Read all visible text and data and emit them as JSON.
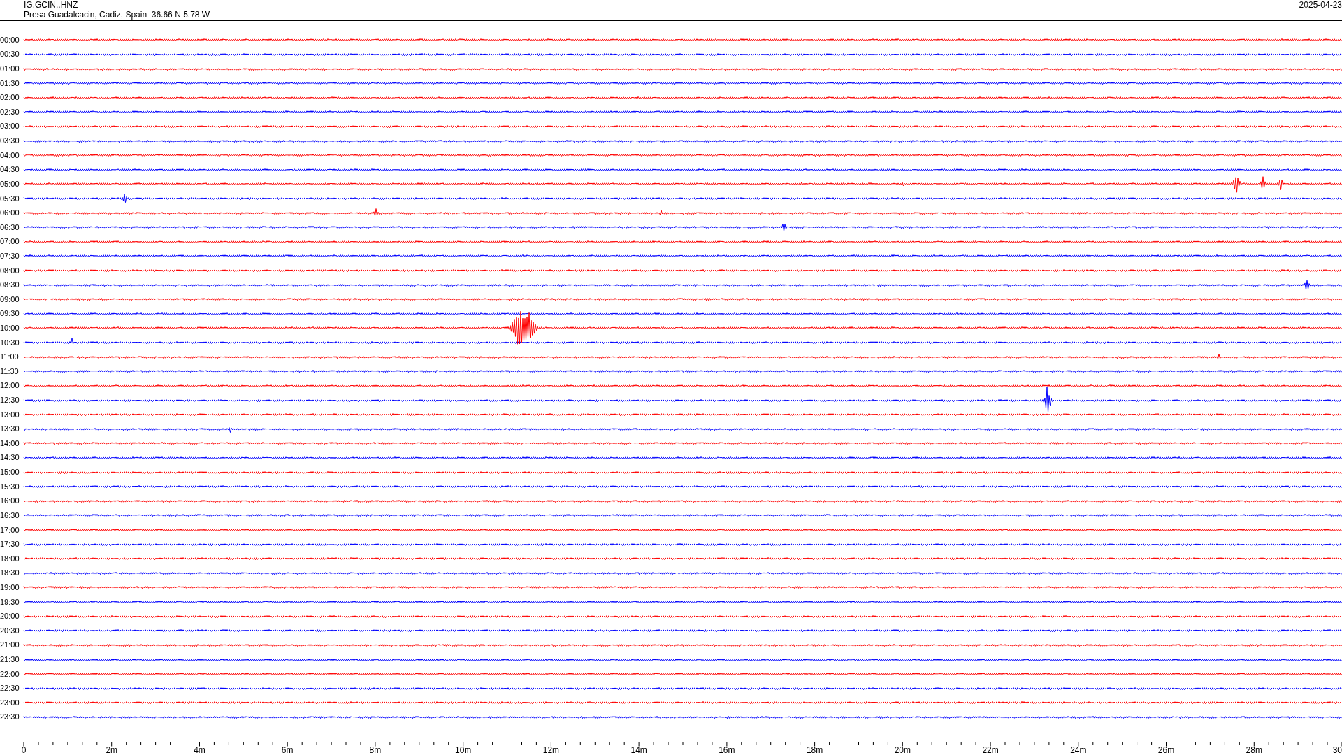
{
  "header": {
    "station": "IG.GCIN..HNZ",
    "location": "Presa Guadalcacin, Cadiz, Spain  36.66 N 5.78 W",
    "date": "2025-04-23"
  },
  "traces": [
    {
      "label": "00:00",
      "color": "#ff0000"
    },
    {
      "label": "00:30",
      "color": "#0000ff"
    },
    {
      "label": "01:00",
      "color": "#ff0000"
    },
    {
      "label": "01:30",
      "color": "#0000ff"
    },
    {
      "label": "02:00",
      "color": "#ff0000"
    },
    {
      "label": "02:30",
      "color": "#0000ff"
    },
    {
      "label": "03:00",
      "color": "#ff0000"
    },
    {
      "label": "03:30",
      "color": "#0000ff"
    },
    {
      "label": "04:00",
      "color": "#ff0000"
    },
    {
      "label": "04:30",
      "color": "#0000ff"
    },
    {
      "label": "05:00",
      "color": "#ff0000"
    },
    {
      "label": "05:30",
      "color": "#0000ff"
    },
    {
      "label": "06:00",
      "color": "#ff0000"
    },
    {
      "label": "06:30",
      "color": "#0000ff"
    },
    {
      "label": "07:00",
      "color": "#ff0000"
    },
    {
      "label": "07:30",
      "color": "#0000ff"
    },
    {
      "label": "08:00",
      "color": "#ff0000"
    },
    {
      "label": "08:30",
      "color": "#0000ff"
    },
    {
      "label": "09:00",
      "color": "#ff0000"
    },
    {
      "label": "09:30",
      "color": "#0000ff"
    },
    {
      "label": "10:00",
      "color": "#ff0000"
    },
    {
      "label": "10:30",
      "color": "#0000ff"
    },
    {
      "label": "11:00",
      "color": "#ff0000"
    },
    {
      "label": "11:30",
      "color": "#0000ff"
    },
    {
      "label": "12:00",
      "color": "#ff0000"
    },
    {
      "label": "12:30",
      "color": "#0000ff"
    },
    {
      "label": "13:00",
      "color": "#ff0000"
    },
    {
      "label": "13:30",
      "color": "#0000ff"
    },
    {
      "label": "14:00",
      "color": "#ff0000"
    },
    {
      "label": "14:30",
      "color": "#0000ff"
    },
    {
      "label": "15:00",
      "color": "#ff0000"
    },
    {
      "label": "15:30",
      "color": "#0000ff"
    },
    {
      "label": "16:00",
      "color": "#ff0000"
    },
    {
      "label": "16:30",
      "color": "#0000ff"
    },
    {
      "label": "17:00",
      "color": "#ff0000"
    },
    {
      "label": "17:30",
      "color": "#0000ff"
    },
    {
      "label": "18:00",
      "color": "#ff0000"
    },
    {
      "label": "18:30",
      "color": "#0000ff"
    },
    {
      "label": "19:00",
      "color": "#ff0000"
    },
    {
      "label": "19:30",
      "color": "#0000ff"
    },
    {
      "label": "20:00",
      "color": "#ff0000"
    },
    {
      "label": "20:30",
      "color": "#0000ff"
    },
    {
      "label": "21:00",
      "color": "#ff0000"
    },
    {
      "label": "21:30",
      "color": "#0000ff"
    },
    {
      "label": "22:00",
      "color": "#ff0000"
    },
    {
      "label": "22:30",
      "color": "#0000ff"
    },
    {
      "label": "23:00",
      "color": "#ff0000"
    },
    {
      "label": "23:30",
      "color": "#0000ff"
    }
  ],
  "time_axis": {
    "labels": [
      "0",
      "2m",
      "4m",
      "6m",
      "8m",
      "10m",
      "12m",
      "14m",
      "16m",
      "18m",
      "20m",
      "22m",
      "24m",
      "26m",
      "28m",
      "30"
    ]
  }
}
